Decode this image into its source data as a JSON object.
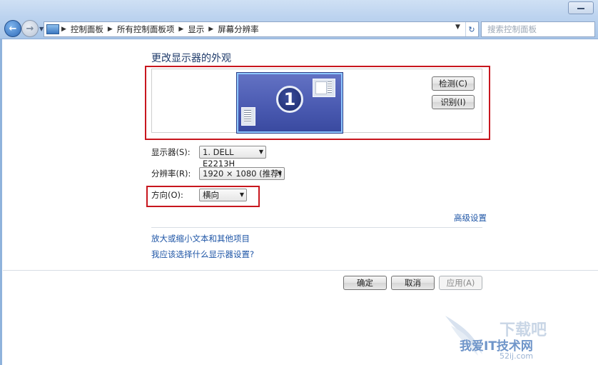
{
  "addressbar": {
    "crumbs": [
      "控制面板",
      "所有控制面板项",
      "显示",
      "屏幕分辨率"
    ],
    "search_placeholder": "搜索控制面板"
  },
  "main": {
    "title": "更改显示器的外观",
    "monitor_number": "1",
    "detect_label": "检测(C)",
    "identify_label": "识别(I)",
    "display_label": "显示器(S):",
    "display_value": "1. DELL E2213H",
    "resolution_label": "分辨率(R):",
    "resolution_value": "1920 × 1080 (推荐)",
    "orientation_label": "方向(O):",
    "orientation_value": "横向",
    "advanced_link": "高级设置",
    "link_text_size": "放大或缩小文本和其他项目",
    "link_which_settings": "我应该选择什么显示器设置?"
  },
  "footer": {
    "ok_label": "确定",
    "cancel_label": "取消",
    "apply_label": "应用(A)"
  },
  "watermark": {
    "text1": "下载吧",
    "text2": "我爱IT技术网",
    "text3": "52ij.com"
  },
  "colors": {
    "highlight": "#c8161e",
    "link": "#1e55a6",
    "monitor": "#4b5bb2"
  }
}
